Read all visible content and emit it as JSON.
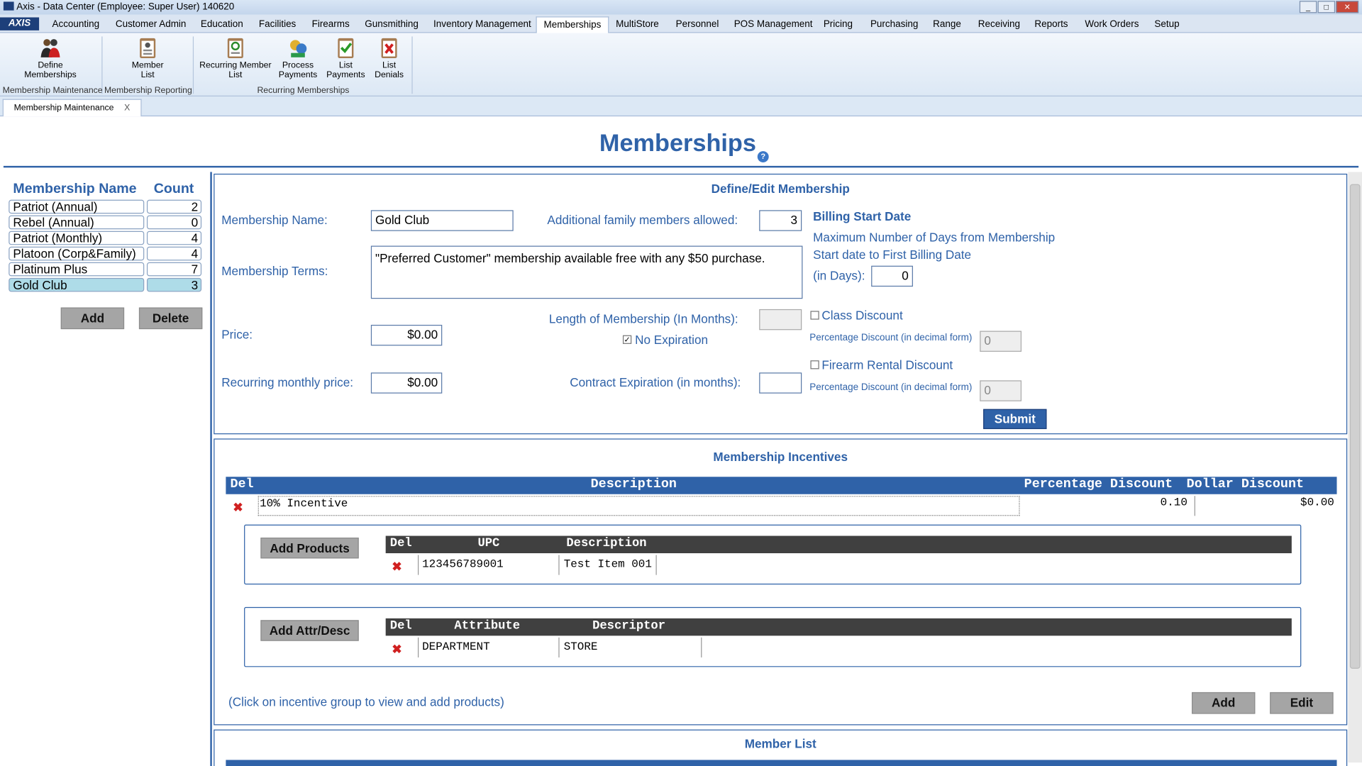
{
  "window": {
    "title": "Axis - Data Center  (Employee: Super User) 140620"
  },
  "menubar": {
    "brand": "AXIS",
    "items": [
      "Accounting",
      "Customer Admin",
      "Education",
      "Facilities",
      "Firearms",
      "Gunsmithing",
      "Inventory Management",
      "Memberships",
      "MultiStore",
      "Personnel",
      "POS Management",
      "Pricing",
      "Purchasing",
      "Range",
      "Receiving",
      "Reports",
      "Work Orders",
      "Setup"
    ],
    "active": "Memberships"
  },
  "ribbon": {
    "buttons": [
      {
        "line1": "Define",
        "line2": "Memberships",
        "icon": "people-icon"
      },
      {
        "line1": "Member",
        "line2": "List",
        "icon": "clipboard-list-icon"
      },
      {
        "line1": "Recurring Member",
        "line2": "List",
        "icon": "recurring-list-icon"
      },
      {
        "line1": "Process",
        "line2": "Payments",
        "icon": "process-payments-icon"
      },
      {
        "line1": "List",
        "line2": "Payments",
        "icon": "checklist-icon"
      },
      {
        "line1": "List",
        "line2": "Denials",
        "icon": "denials-icon"
      }
    ],
    "groups": [
      "Membership Maintenance",
      "Membership Reporting",
      "Recurring Memberships"
    ]
  },
  "doc_tab": {
    "label": "Membership Maintenance",
    "close": "X"
  },
  "page": {
    "title": "Memberships",
    "help": "?"
  },
  "membership_list": {
    "header_name": "Membership Name",
    "header_count": "Count",
    "rows": [
      {
        "name": "Patriot (Annual)",
        "count": "2"
      },
      {
        "name": "Rebel (Annual)",
        "count": "0"
      },
      {
        "name": "Patriot (Monthly)",
        "count": "4"
      },
      {
        "name": "Platoon (Corp&Family)",
        "count": "4"
      },
      {
        "name": "Platinum Plus",
        "count": "7"
      },
      {
        "name": "Gold Club",
        "count": "3"
      }
    ],
    "add_label": "Add",
    "delete_label": "Delete"
  },
  "define_edit": {
    "title": "Define/Edit Membership",
    "name_label": "Membership Name:",
    "name_value": "Gold Club",
    "family_label": "Additional family members allowed:",
    "family_value": "3",
    "terms_label": "Membership Terms:",
    "terms_value": "\"Preferred Customer\" membership available free with any $50 purchase.",
    "price_label": "Price:",
    "price_value": "$0.00",
    "length_label": "Length of Membership (In Months):",
    "length_value": "",
    "no_expiration_label": "No Expiration",
    "no_expiration_checked": "✓",
    "recurring_label": "Recurring monthly price:",
    "recurring_value": "$0.00",
    "contract_label": "Contract Expiration (in months):",
    "contract_value": "",
    "billing_title": "Billing Start Date",
    "billing_line1": "Maximum Number of Days from Membership",
    "billing_line2": "Start date to First Billing Date",
    "billing_days_label": "(in Days):",
    "billing_days_value": "0",
    "class_discount_label": "Class Discount",
    "class_pct_label": "Percentage Discount (in decimal form)",
    "class_pct_value": "0",
    "rental_discount_label": "Firearm Rental Discount",
    "rental_pct_label": "Percentage Discount (in decimal form)",
    "rental_pct_value": "0",
    "submit_label": "Submit"
  },
  "incentives": {
    "title": "Membership Incentives",
    "col_del": "Del",
    "col_desc": "Description",
    "col_pct": "Percentage Discount",
    "col_dollar": "Dollar Discount",
    "rows": [
      {
        "description": "10% Incentive",
        "pct": "0.10",
        "dollar": "$0.00"
      }
    ],
    "products": {
      "add_label": "Add Products",
      "col_del": "Del",
      "col_upc": "UPC",
      "col_desc": "Description",
      "rows": [
        {
          "upc": "123456789001",
          "description": "Test Item 001"
        }
      ]
    },
    "attrs": {
      "add_label": "Add Attr/Desc",
      "col_del": "Del",
      "col_attr": "Attribute",
      "col_desc": "Descriptor",
      "rows": [
        {
          "attribute": "DEPARTMENT",
          "descriptor": "STORE"
        }
      ]
    },
    "note": "(Click on incentive group to view and add products)",
    "add_label": "Add",
    "edit_label": "Edit"
  },
  "member_list": {
    "title": "Member List"
  }
}
